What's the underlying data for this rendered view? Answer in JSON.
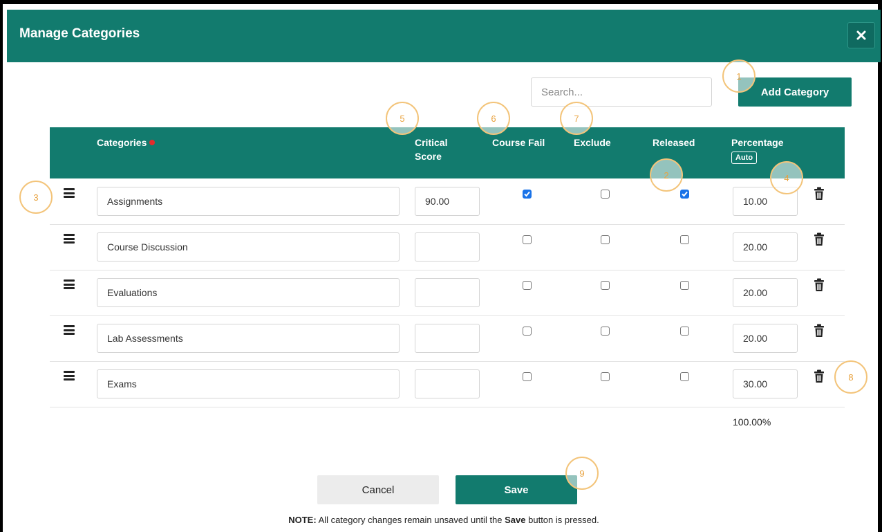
{
  "dialog": {
    "title": "Manage Categories",
    "close_label": "×"
  },
  "toolbar": {
    "search_placeholder": "Search...",
    "add_label": "Add Category"
  },
  "table": {
    "headers": {
      "categories": "Categories",
      "critical_score_line1": "Critical",
      "critical_score_line2": "Score",
      "course_fail": "Course Fail",
      "exclude": "Exclude",
      "released": "Released",
      "percentage": "Percentage",
      "auto": "Auto"
    },
    "rows": [
      {
        "name": "Assignments",
        "critical_score": "90.00",
        "course_fail": true,
        "exclude": false,
        "released": true,
        "percentage": "10.00"
      },
      {
        "name": "Course Discussion",
        "critical_score": "",
        "course_fail": false,
        "exclude": false,
        "released": false,
        "percentage": "20.00"
      },
      {
        "name": "Evaluations",
        "critical_score": "",
        "course_fail": false,
        "exclude": false,
        "released": false,
        "percentage": "20.00"
      },
      {
        "name": "Lab Assessments",
        "critical_score": "",
        "course_fail": false,
        "exclude": false,
        "released": false,
        "percentage": "20.00"
      },
      {
        "name": "Exams",
        "critical_score": "",
        "course_fail": false,
        "exclude": false,
        "released": false,
        "percentage": "30.00"
      }
    ],
    "total": "100.00%"
  },
  "footer": {
    "cancel_label": "Cancel",
    "save_label": "Save",
    "note_prefix": "NOTE:",
    "note_text": " All category changes remain unsaved until the ",
    "note_bold": "Save",
    "note_suffix": " button is pressed."
  },
  "callouts": [
    "1",
    "2",
    "3",
    "4",
    "5",
    "6",
    "7",
    "8",
    "9"
  ],
  "colors": {
    "brand": "#127b6e",
    "checkbox_checked": "#1a73e8",
    "required_dot": "#e62b2b",
    "callout": "#f3c47a"
  }
}
